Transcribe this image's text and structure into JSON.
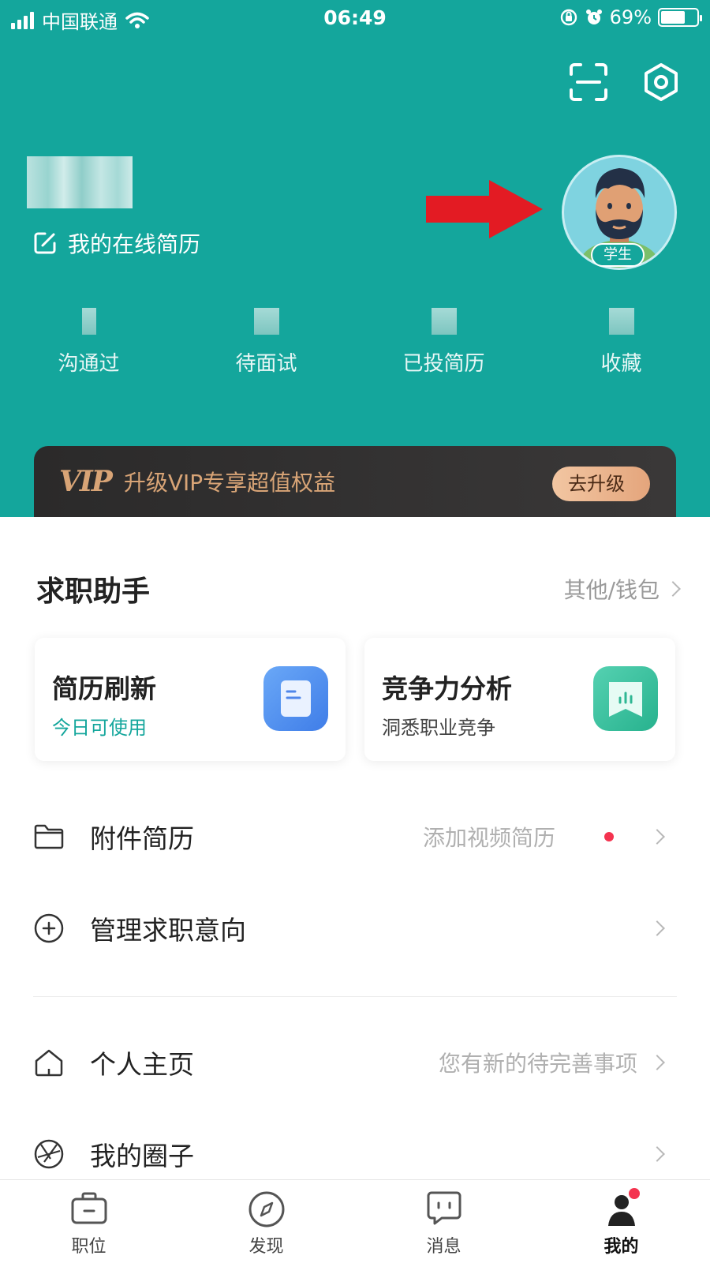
{
  "status_bar": {
    "carrier": "中国联通",
    "time": "06:49",
    "battery": "69%",
    "battery_level": 0.69
  },
  "header": {
    "resume_link": "我的在线简历",
    "avatar_badge": "学生",
    "stats": [
      {
        "label": "沟通过"
      },
      {
        "label": "待面试"
      },
      {
        "label": "已投简历"
      },
      {
        "label": "收藏"
      }
    ]
  },
  "vip": {
    "logo": "VIP",
    "text": "升级VIP专享超值权益",
    "button": "去升级"
  },
  "assistant": {
    "title": "求职助手",
    "more": "其他/钱包",
    "cards": [
      {
        "title": "简历刷新",
        "subtitle": "今日可使用"
      },
      {
        "title": "竞争力分析",
        "subtitle": "洞悉职业竞争"
      }
    ]
  },
  "menu": {
    "attachment": {
      "label": "附件简历",
      "hint": "添加视频简历"
    },
    "intent": {
      "label": "管理求职意向"
    },
    "homepage": {
      "label": "个人主页",
      "hint": "您有新的待完善事项"
    },
    "circle": {
      "label": "我的圈子"
    }
  },
  "tabbar": [
    {
      "label": "职位"
    },
    {
      "label": "发现"
    },
    {
      "label": "消息"
    },
    {
      "label": "我的"
    }
  ],
  "colors": {
    "brand": "#14a69c",
    "vip_gold": "#d8a476",
    "notice_red": "#f4334f"
  }
}
